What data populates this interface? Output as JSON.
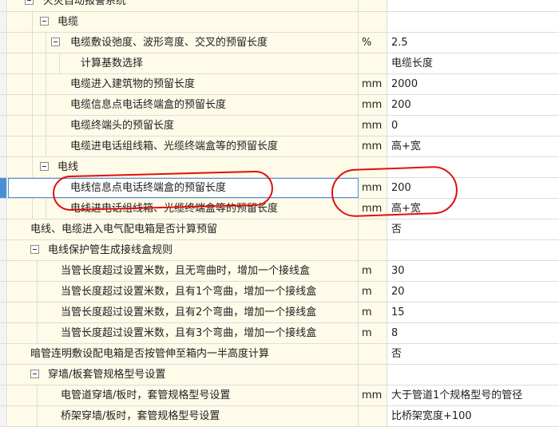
{
  "rows": [
    {
      "label": "火灾自动报警系统",
      "unit": "",
      "value": ""
    },
    {
      "label": "电缆",
      "unit": "",
      "value": ""
    },
    {
      "label": "电缆敷设弛度、波形弯度、交叉的预留长度",
      "unit": "%",
      "value": "2.5"
    },
    {
      "label": "计算基数选择",
      "unit": "",
      "value": "电缆长度"
    },
    {
      "label": "电缆进入建筑物的预留长度",
      "unit": "mm",
      "value": "2000"
    },
    {
      "label": "电缆信息点电话终端盒的预留长度",
      "unit": "mm",
      "value": "200"
    },
    {
      "label": "电缆终端头的预留长度",
      "unit": "mm",
      "value": "0"
    },
    {
      "label": "电缆进电话组线箱、光缆终端盒等的预留长度",
      "unit": "mm",
      "value": "高+宽"
    },
    {
      "label": "电线",
      "unit": "",
      "value": ""
    },
    {
      "label": "电线信息点电话终端盒的预留长度",
      "unit": "mm",
      "value": "200"
    },
    {
      "label": "电线进电话组线箱、光缆终端盒等的预留长度",
      "unit": "mm",
      "value": "高+宽"
    },
    {
      "label": "电线、电缆进入电气配电箱是否计算预留",
      "unit": "",
      "value": "否"
    },
    {
      "label": "电线保护管生成接线盒规则",
      "unit": "",
      "value": ""
    },
    {
      "label": "当管长度超过设置米数，且无弯曲时，增加一个接线盒",
      "unit": "m",
      "value": "30"
    },
    {
      "label": "当管长度超过设置米数，且有1个弯曲，增加一个接线盒",
      "unit": "m",
      "value": "20"
    },
    {
      "label": "当管长度超过设置米数，且有2个弯曲，增加一个接线盒",
      "unit": "m",
      "value": "15"
    },
    {
      "label": "当管长度超过设置米数，且有3个弯曲，增加一个接线盒",
      "unit": "m",
      "value": "8"
    },
    {
      "label": "暗管连明敷设配电箱是否按管伸至箱内一半高度计算",
      "unit": "",
      "value": "否"
    },
    {
      "label": "穿墙/板套管规格型号设置",
      "unit": "",
      "value": ""
    },
    {
      "label": "电管道穿墙/板时，套管规格型号设置",
      "unit": "mm",
      "value": "大于管道1个规格型号的管径"
    },
    {
      "label": "桥架穿墙/板时，套管规格型号设置",
      "unit": "",
      "value": "比桥架宽度+100"
    }
  ]
}
